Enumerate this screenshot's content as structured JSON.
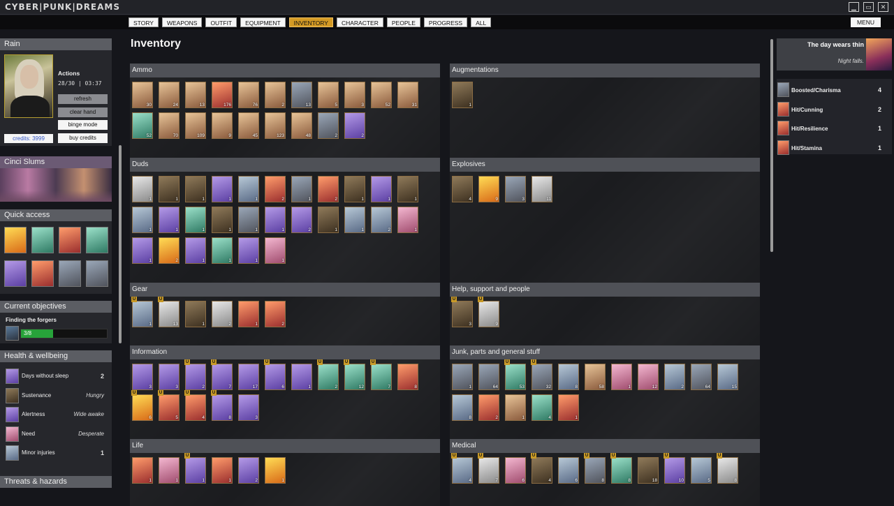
{
  "app": {
    "logo": "CYBER|PUNK|DREAMS",
    "window_buttons": [
      "minimize-icon",
      "maximize-icon",
      "close-icon"
    ]
  },
  "nav": {
    "tabs": [
      "STORY",
      "WEAPONS",
      "OUTFIT",
      "EQUIPMENT",
      "INVENTORY",
      "CHARACTER",
      "PEOPLE",
      "PROGRESS",
      "ALL"
    ],
    "active_tab": "INVENTORY",
    "menu_label": "MENU"
  },
  "character": {
    "name": "Rain",
    "actions_label": "Actions",
    "stats": "28/30 | 03:37",
    "credits": "credits: 3999",
    "buttons": {
      "refresh": "refresh",
      "clear_hand": "clear hand",
      "binge_mode": "binge mode",
      "buy_credits": "buy credits"
    }
  },
  "location": {
    "name": "Cinci Slums"
  },
  "quick_access": {
    "title": "Quick access",
    "slots": 8
  },
  "objectives": {
    "title": "Current objectives",
    "item": "Finding the forgers",
    "progress_text": "3/8",
    "progress": 0.375
  },
  "health": {
    "title": "Health & wellbeing",
    "rows": [
      {
        "label": "Days without sleep",
        "value": "2"
      },
      {
        "label": "Sustenance",
        "value": "Hungry"
      },
      {
        "label": "Alertness",
        "value": "Wide awake"
      },
      {
        "label": "Need",
        "value": "Desperate"
      },
      {
        "label": "Minor injuries",
        "value": "1"
      }
    ]
  },
  "threats": {
    "title": "Threats & hazards"
  },
  "main": {
    "title": "Inventory"
  },
  "sections": [
    {
      "title": "Ammo",
      "items": [
        [
          "30",
          0
        ],
        [
          "24",
          0
        ],
        [
          "13",
          0
        ],
        [
          "176",
          4
        ],
        [
          "76",
          0
        ],
        [
          "2",
          0
        ],
        [
          "13",
          1
        ],
        [
          "5",
          0
        ],
        [
          "3",
          0
        ],
        [
          "52",
          0
        ],
        [
          "31",
          0
        ],
        [
          "52",
          3
        ],
        [
          "70",
          0
        ],
        [
          "109",
          0
        ],
        [
          "9",
          0
        ],
        [
          "45",
          0
        ],
        [
          "123",
          0
        ],
        [
          "48",
          0
        ],
        [
          "2",
          1
        ],
        [
          "2",
          2
        ]
      ]
    },
    {
      "title": "Augmentations",
      "items": [
        [
          "1",
          8
        ]
      ]
    },
    {
      "title": "Duds",
      "items": [
        [
          "1",
          7
        ],
        [
          "1",
          8
        ],
        [
          "1",
          8
        ],
        [
          "1",
          2
        ],
        [
          "1",
          6
        ],
        [
          "2",
          4
        ],
        [
          "1",
          1
        ],
        [
          "2",
          4
        ],
        [
          "1",
          8
        ],
        [
          "1",
          2
        ],
        [
          "1",
          8
        ],
        [
          "1",
          6
        ],
        [
          "1",
          2
        ],
        [
          "1",
          3
        ],
        [
          "1",
          8
        ],
        [
          "1",
          1
        ],
        [
          "1",
          2
        ],
        [
          "2",
          2
        ],
        [
          "1",
          8
        ],
        [
          "1",
          6
        ],
        [
          "2",
          6
        ],
        [
          "1",
          9
        ],
        [
          "1",
          2
        ],
        [
          "2",
          5
        ],
        [
          "1",
          2
        ],
        [
          "1",
          3
        ],
        [
          "1",
          2
        ],
        [
          "1",
          9
        ]
      ]
    },
    {
      "title": "Explosives",
      "items": [
        [
          "4",
          8
        ],
        [
          "9",
          5
        ],
        [
          "3",
          1
        ],
        [
          "11",
          7
        ]
      ]
    },
    {
      "title": "Gear",
      "items": [
        [
          "1",
          6,
          1
        ],
        [
          "13",
          7,
          1
        ],
        [
          "1",
          8
        ],
        [
          "2",
          7
        ],
        [
          "1",
          4
        ],
        [
          "2",
          4
        ]
      ]
    },
    {
      "title": "Help, support and people",
      "items": [
        [
          "3",
          8,
          1
        ],
        [
          "9",
          7,
          1
        ]
      ]
    },
    {
      "title": "Information",
      "items": [
        [
          "3",
          2
        ],
        [
          "3",
          2
        ],
        [
          "2",
          2,
          1
        ],
        [
          "7",
          2,
          1
        ],
        [
          "17",
          2
        ],
        [
          "6",
          2,
          1
        ],
        [
          "1",
          2
        ],
        [
          "2",
          3,
          1
        ],
        [
          "12",
          3,
          1
        ],
        [
          "7",
          3,
          1
        ],
        [
          "8",
          4
        ],
        [
          "6",
          5,
          1
        ],
        [
          "5",
          4,
          1
        ],
        [
          "4",
          4,
          1
        ],
        [
          "8",
          2,
          1
        ],
        [
          "3",
          2
        ]
      ]
    },
    {
      "title": "Junk, parts and general stuff",
      "items": [
        [
          "1",
          1
        ],
        [
          "64",
          1
        ],
        [
          "53",
          3,
          1
        ],
        [
          "32",
          1,
          1
        ],
        [
          "8",
          6
        ],
        [
          "58",
          0
        ],
        [
          "1",
          9
        ],
        [
          "12",
          9
        ],
        [
          "2",
          6
        ],
        [
          "64",
          1
        ],
        [
          "15",
          6
        ],
        [
          "8",
          6
        ],
        [
          "2",
          4
        ],
        [
          "1",
          0
        ],
        [
          "4",
          3
        ],
        [
          "1",
          4
        ]
      ]
    },
    {
      "title": "Life",
      "items": [
        [
          "1",
          4
        ],
        [
          "1",
          9
        ],
        [
          "1",
          2,
          1
        ],
        [
          "1",
          4
        ],
        [
          "2",
          2
        ],
        [
          "1",
          5
        ]
      ]
    },
    {
      "title": "Medical",
      "items": [
        [
          "4",
          6,
          1
        ],
        [
          "7",
          7,
          1
        ],
        [
          "6",
          9
        ],
        [
          "4",
          8,
          1
        ],
        [
          "6",
          6
        ],
        [
          "8",
          1,
          1
        ],
        [
          "8",
          3,
          1
        ],
        [
          "18",
          8
        ],
        [
          "10",
          2,
          1
        ],
        [
          "5",
          6
        ],
        [
          "8",
          7,
          1
        ]
      ]
    }
  ],
  "event": {
    "title": "The day wears thin",
    "subtitle": "Night falls."
  },
  "effects": [
    {
      "label": "Boosted/Charisma",
      "value": "4"
    },
    {
      "label": "Hit/Cunning",
      "value": "2"
    },
    {
      "label": "Hit/Resilience",
      "value": "1"
    },
    {
      "label": "Hit/Stamina",
      "value": "1"
    }
  ]
}
